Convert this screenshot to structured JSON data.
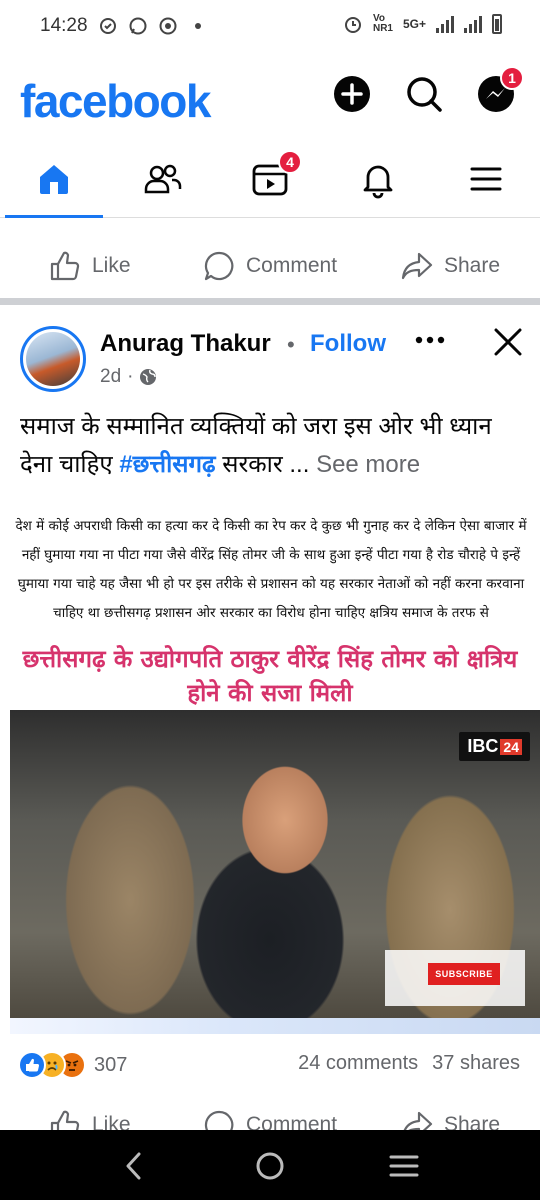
{
  "status_bar": {
    "time": "14:28",
    "network_vo": "Vo",
    "network_nr": "NR1",
    "network_type": "5G+"
  },
  "header": {
    "logo": "facebook",
    "icons": [
      "plus-circle-icon",
      "search-icon",
      "messenger-icon"
    ],
    "messenger_badge": "1"
  },
  "nav": {
    "tabs": [
      "home",
      "friends",
      "video",
      "notifications",
      "menu"
    ],
    "video_badge": "4",
    "active": "home"
  },
  "top_actions": {
    "like": "Like",
    "comment": "Comment",
    "share": "Share"
  },
  "post": {
    "author": "Anurag Thakur",
    "separator": "•",
    "follow": "Follow",
    "time": "2d",
    "privacy": "globe-icon",
    "text_main": "समाज के सम्मानित व्यक्तियों को जरा इस ओर भी ध्यान देना चाहिए ",
    "hashtag": "#छत्तीसगढ़",
    "text_after": " सरकार ...",
    "see_more": "See more",
    "card_text": "देश में कोई अपराधी किसी का हत्या कर दे किसी का रेप कर दे कुछ भी गुनाह कर दे लेकिन ऐसा बाजार में नहीं घुमाया गया ना पीटा गया जैसे वीरेंद्र सिंह तोमर जी के साथ हुआ इन्हें पीटा गया है  रोड चौराहे पे इन्हें घुमाया गया चाहे यह जैसा भी हो पर इस  तरीके से प्रशासन  को यह सरकार नेताओं को नहीं करना करवाना चाहिए था छत्तीसगढ़ प्रशासन ओर सरकार का विरोध होना चाहिए क्षत्रिय समाज के तरफ से",
    "card_headline": "छत्तीसगढ़ के उद्योगपति ठाकुर वीरेंद्र सिंह तोमर को क्षत्रिय होने की सजा मिली",
    "channel_logo_a": "IBC",
    "channel_logo_b": "24",
    "subscribe": "SUBSCRIBE",
    "reaction_count": "307",
    "comments": "24 comments",
    "shares": "37 shares"
  },
  "bottom_actions": {
    "like": "Like",
    "comment": "Comment",
    "share": "Share"
  },
  "colors": {
    "brand": "#1877f2",
    "badge": "#e41e3f",
    "headline": "#d6336c"
  }
}
